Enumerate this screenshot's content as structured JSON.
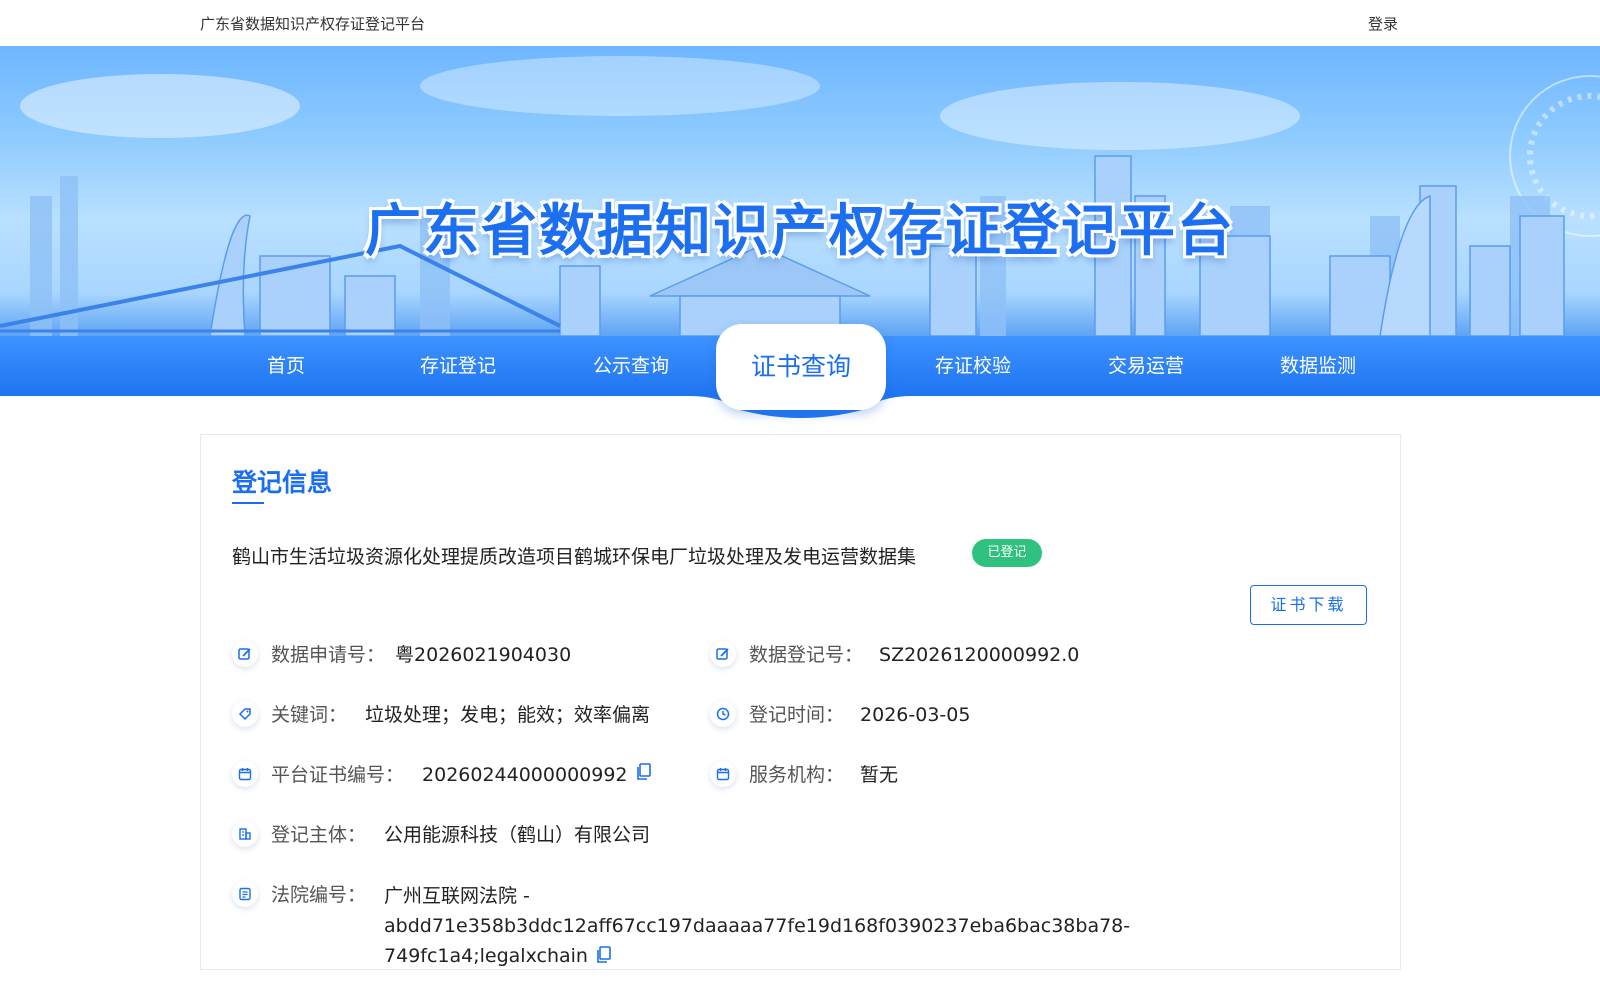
{
  "topbar": {
    "site_name": "广东省数据知识产权存证登记平台",
    "login": "登录"
  },
  "banner": {
    "title": "广东省数据知识产权存证登记平台"
  },
  "nav": {
    "items": [
      "首页",
      "存证登记",
      "公示查询",
      "证书查询",
      "存证校验",
      "交易运营",
      "数据监测"
    ],
    "active": "证书查询"
  },
  "card": {
    "section_title": "登记信息",
    "record_title": "鹤山市生活垃圾资源化处理提质改造项目鹤城环保电厂垃圾处理及发电运营数据集",
    "status": "已登记",
    "download_button": "证书下载",
    "fields": {
      "application_no": {
        "label": "数据申请号：",
        "value": "粤2026021904030"
      },
      "registration_no": {
        "label": "数据登记号：",
        "value": "SZ2026120000992.0"
      },
      "keywords": {
        "label": "关键词：",
        "value": "垃圾处理；发电；能效；效率偏离"
      },
      "registration_time": {
        "label": "登记时间：",
        "value": "2026-03-05"
      },
      "certificate_no": {
        "label": "平台证书编号：",
        "value": "20260244000000992"
      },
      "service_agency": {
        "label": "服务机构：",
        "value": "暂无"
      },
      "registrant": {
        "label": "登记主体：",
        "value": "公用能源科技（鹤山）有限公司"
      },
      "court_no": {
        "label": "法院编号：",
        "value": "广州互联网法院 - abdd71e358b3ddc12aff67cc197daaaaa77fe19d168f0390237eba6bac38ba78-749fc1a4;legalxchain"
      }
    }
  },
  "colors": {
    "accent": "#1a6ef0",
    "nav_bg": "#2a80f6",
    "badge_green": "#2ec27e"
  },
  "icons": {
    "field_icons": [
      "edit-icon",
      "edit-icon",
      "tag-icon",
      "clock-icon",
      "calendar-icon",
      "calendar-icon",
      "building-icon",
      "document-icon"
    ],
    "copy": "copy-icon"
  }
}
